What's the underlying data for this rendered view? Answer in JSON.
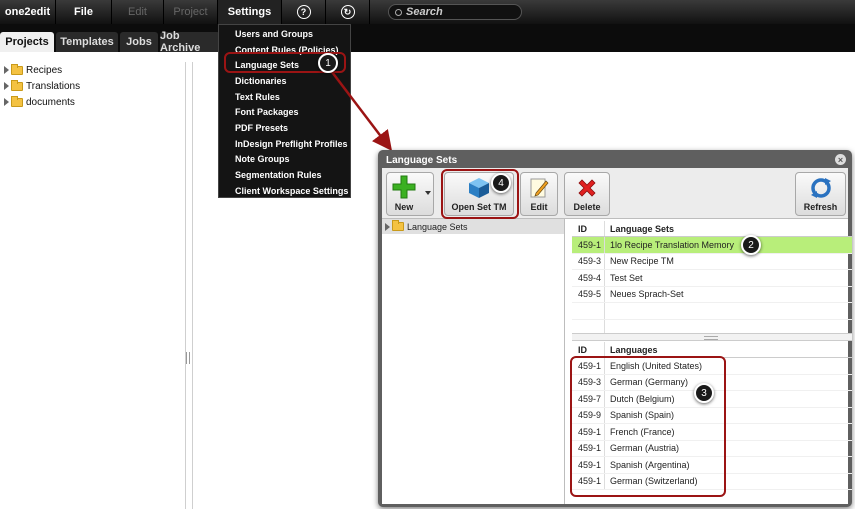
{
  "topbar": {
    "menus": [
      {
        "label": "one2edit",
        "state": "normal"
      },
      {
        "label": "File",
        "state": "normal"
      },
      {
        "label": "Edit",
        "state": "disabled"
      },
      {
        "label": "Project",
        "state": "disabled"
      },
      {
        "label": "Settings",
        "state": "active"
      }
    ],
    "help_icon": "?",
    "refresh_icon": "↻",
    "search_placeholder": "Search"
  },
  "tabs": [
    "Projects",
    "Templates",
    "Jobs",
    "Job Archive"
  ],
  "tree": [
    "Recipes",
    "Translations",
    "documents"
  ],
  "settings_menu": [
    "Users and Groups",
    "Content Rules (Policies)",
    "Language Sets",
    "Dictionaries",
    "Text Rules",
    "Font Packages",
    "PDF Presets",
    "InDesign Preflight Profiles",
    "Note Groups",
    "Segmentation Rules",
    "Client Workspace Settings"
  ],
  "callouts": [
    "1",
    "2",
    "3",
    "4"
  ],
  "dialog": {
    "title": "Language Sets",
    "close_icon": "×",
    "buttons": {
      "new": "New",
      "open_set_tm": "Open Set TM",
      "edit": "Edit",
      "delete": "Delete",
      "refresh": "Refresh"
    },
    "tree_root": "Language Sets",
    "sets_header": {
      "id": "ID",
      "name": "Language Sets"
    },
    "sets": [
      {
        "id": "459-1",
        "name": "1lo Recipe Translation Memory"
      },
      {
        "id": "459-3",
        "name": "New Recipe TM"
      },
      {
        "id": "459-4",
        "name": "Test Set"
      },
      {
        "id": "459-5",
        "name": "Neues Sprach-Set"
      }
    ],
    "languages_header": {
      "id": "ID",
      "name": "Languages"
    },
    "languages": [
      {
        "id": "459-1",
        "name": "English (United States)"
      },
      {
        "id": "459-3",
        "name": "German (Germany)"
      },
      {
        "id": "459-7",
        "name": "Dutch (Belgium)"
      },
      {
        "id": "459-9",
        "name": "Spanish (Spain)"
      },
      {
        "id": "459-1",
        "name": "French (France)"
      },
      {
        "id": "459-1",
        "name": "German (Austria)"
      },
      {
        "id": "459-1",
        "name": "Spanish (Argentina)"
      },
      {
        "id": "459-1",
        "name": "German (Switzerland)"
      }
    ]
  },
  "colors": {
    "highlight_row": "#b8ee7a",
    "annotation_red": "#9b1414"
  }
}
